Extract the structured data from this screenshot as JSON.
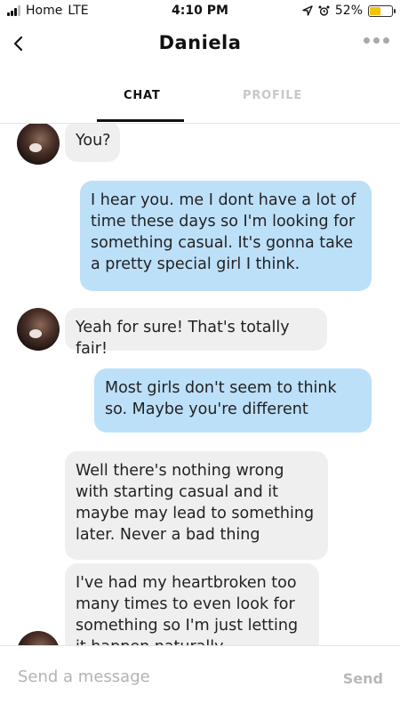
{
  "status_bar": {
    "carrier": "Home",
    "network": "LTE",
    "time": "4:10 PM",
    "battery_percent": "52%",
    "battery_level": 0.52
  },
  "header": {
    "title": "Daniela",
    "back_icon": "chevron-left-icon",
    "more_icon": "more-horizontal-icon"
  },
  "tabs": [
    {
      "label": "CHAT",
      "active": true
    },
    {
      "label": "PROFILE",
      "active": false
    }
  ],
  "messages": [
    {
      "from": "them",
      "text": "You?"
    },
    {
      "from": "me",
      "text": "I hear you. me I dont have a lot of time these days so I'm looking for something casual. It's gonna take a pretty special girl I think."
    },
    {
      "from": "them",
      "text": "Yeah for sure! That's totally fair!"
    },
    {
      "from": "me",
      "text": "Most girls don't seem to think so. Maybe you're different"
    },
    {
      "from": "them",
      "text": "Well there's nothing wrong with starting casual and it maybe may lead to something later. Never a bad thing"
    },
    {
      "from": "them",
      "text": "I've had my heartbroken too many times to even look for something so I'm just letting it happen naturally"
    }
  ],
  "composer": {
    "placeholder": "Send a message",
    "value": "",
    "send_label": "Send"
  },
  "colors": {
    "sent_bubble": "#bde0f9",
    "received_bubble": "#efefef",
    "battery": "#f5c400"
  }
}
